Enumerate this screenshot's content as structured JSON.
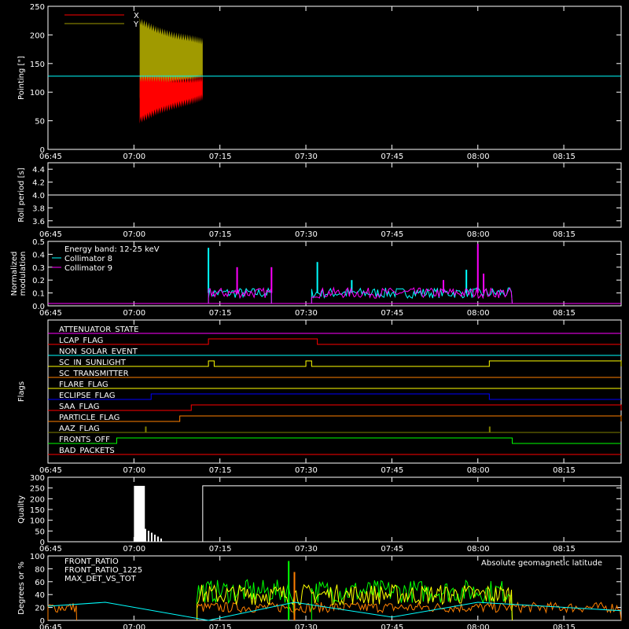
{
  "time_ticks": [
    "06:45",
    "07:00",
    "07:15",
    "07:30",
    "07:45",
    "08:00",
    "08:15"
  ],
  "colors": {
    "background": "#000000",
    "axes": "#ffffff",
    "red": "#ff0000",
    "olive": "#a09a00",
    "cyan": "#00ffff",
    "magenta": "#ff00ff",
    "green": "#00ff00",
    "orange": "#ff8000",
    "blue": "#0000ff",
    "yellow": "#ffff00"
  },
  "chart_data": [
    {
      "type": "line",
      "ylabel": "Pointing [\"]",
      "ylim": [
        0,
        250
      ],
      "yticks": [
        "0",
        "50",
        "100",
        "150",
        "200",
        "250"
      ],
      "legend_placement": "top-left",
      "series": [
        {
          "name": "X",
          "color": "#ff0000",
          "x": [
            "07:01",
            "07:04",
            "07:07",
            "07:10",
            "07:12"
          ],
          "low": [
            45,
            60,
            70,
            78,
            85
          ],
          "high": [
            130,
            130,
            128,
            128,
            130
          ]
        },
        {
          "name": "Y",
          "color": "#a09a00",
          "x": [
            "07:01",
            "07:04",
            "07:07",
            "07:10",
            "07:12"
          ],
          "low": [
            88,
            100,
            110,
            115,
            120
          ],
          "high": [
            230,
            215,
            205,
            200,
            195
          ]
        }
      ],
      "reference_line": {
        "y": 128,
        "color": "#00ffff"
      }
    },
    {
      "type": "line",
      "ylabel": "Roll period [s]",
      "ylim": [
        3.5,
        4.5
      ],
      "yticks": [
        "3.6",
        "3.8",
        "4.0",
        "4.2",
        "4.4"
      ],
      "series": [
        {
          "color": "#ffffff",
          "x": [
            "06:45",
            "08:25"
          ],
          "y": [
            4.0,
            4.0
          ]
        }
      ]
    },
    {
      "type": "line",
      "ylabel": "Normalized modulation",
      "ylim": [
        0,
        0.5
      ],
      "yticks": [
        "0.0",
        "0.1",
        "0.2",
        "0.3",
        "0.4",
        "0.5"
      ],
      "legend_placement": "top-left",
      "legend_title": "Energy band: 12-25 keV",
      "series": [
        {
          "name": "Collimator 8",
          "color": "#00ffff",
          "active_ranges": [
            [
              "07:13",
              "07:24"
            ],
            [
              "07:31",
              "08:06"
            ]
          ],
          "base": 0.1,
          "peaks": [
            [
              "07:13",
              0.45
            ],
            [
              "07:32",
              0.34
            ],
            [
              "07:38",
              0.2
            ],
            [
              "07:58",
              0.28
            ],
            [
              "08:01",
              0.2
            ]
          ]
        },
        {
          "name": "Collimator 9",
          "color": "#ff00ff",
          "active_ranges": [
            [
              "07:13",
              "07:24"
            ],
            [
              "07:31",
              "08:06"
            ]
          ],
          "base": 0.1,
          "peaks": [
            [
              "07:18",
              0.3
            ],
            [
              "07:24",
              0.3
            ],
            [
              "07:54",
              0.2
            ],
            [
              "08:00",
              0.48
            ],
            [
              "08:01",
              0.25
            ]
          ]
        }
      ]
    },
    {
      "type": "line",
      "ylabel": "Flags",
      "flags": [
        {
          "name": "ATTENUATOR_STATE",
          "color": "#ff00ff",
          "changes": []
        },
        {
          "name": "LCAP_FLAG",
          "color": "#ff0000",
          "changes": [
            [
              "07:13",
              "07:32"
            ]
          ]
        },
        {
          "name": "NON_SOLAR_EVENT",
          "color": "#00ffff",
          "changes": []
        },
        {
          "name": "SC_IN_SUNLIGHT",
          "color": "#ffff00",
          "changes": [
            [
              "07:13",
              "07:14"
            ],
            [
              "07:30",
              "07:31"
            ],
            [
              "08:02",
              "08:25"
            ]
          ]
        },
        {
          "name": "SC_TRANSMITTER",
          "color": "#ff8000",
          "changes": []
        },
        {
          "name": "FLARE_FLAG",
          "color": "#ffff00",
          "changes": []
        },
        {
          "name": "ECLIPSE_FLAG",
          "color": "#0000ff",
          "changes": [
            [
              "07:03",
              "08:02"
            ]
          ]
        },
        {
          "name": "SAA_FLAG",
          "color": "#ff0000",
          "changes": [
            [
              "07:10",
              "08:25"
            ]
          ]
        },
        {
          "name": "PARTICLE_FLAG",
          "color": "#ff8000",
          "changes": [
            [
              "07:08",
              "08:25"
            ]
          ]
        },
        {
          "name": "AAZ_FLAG",
          "color": "#808000",
          "changes": [
            [
              "07:02",
              "07:02"
            ],
            [
              "08:02",
              "08:02"
            ]
          ]
        },
        {
          "name": "FRONTS_OFF",
          "color": "#00ff00",
          "changes": [
            [
              "06:57",
              "08:06"
            ]
          ]
        },
        {
          "name": "BAD_PACKETS",
          "color": "#ff0000",
          "changes": []
        }
      ]
    },
    {
      "type": "bar",
      "ylabel": "Quality",
      "ylim": [
        0,
        300
      ],
      "yticks": [
        "0",
        "50",
        "100",
        "150",
        "200",
        "250",
        "300"
      ],
      "series": [
        {
          "color": "#ffffff",
          "x": [
            "06:45",
            "07:00",
            "07:03",
            "07:12",
            "08:25"
          ],
          "y": [
            0,
            260,
            40,
            260,
            260
          ]
        }
      ]
    },
    {
      "type": "line",
      "ylabel": "Degrees or %",
      "ylim": [
        0,
        100
      ],
      "yticks": [
        "0",
        "20",
        "40",
        "60",
        "80",
        "100"
      ],
      "legend_placement": "top-left",
      "annotation": "Absolute geomagnetic latitude",
      "series": [
        {
          "name": "FRONT_RATIO",
          "color": "#ffff00",
          "active_ranges": [
            [
              "07:11",
              "08:06"
            ]
          ],
          "level": 40
        },
        {
          "name": "FRONT_RATIO_1225",
          "color": "#00ff00",
          "active_ranges": [
            [
              "07:11",
              "07:28"
            ],
            [
              "07:31",
              "08:06"
            ]
          ],
          "level": 45
        },
        {
          "name": "MAX_DET_VS_TOT",
          "color": "#ff8000",
          "active_ranges": [
            [
              "06:45",
              "06:50"
            ],
            [
              "07:11",
              "08:25"
            ]
          ],
          "level": 20
        },
        {
          "name": "Absolute geomagnetic latitude",
          "color": "#00ffff",
          "x": [
            "06:45",
            "06:55",
            "07:13",
            "07:28",
            "07:45",
            "08:00",
            "08:25"
          ],
          "y": [
            22,
            28,
            0,
            28,
            5,
            28,
            15
          ]
        }
      ]
    }
  ]
}
